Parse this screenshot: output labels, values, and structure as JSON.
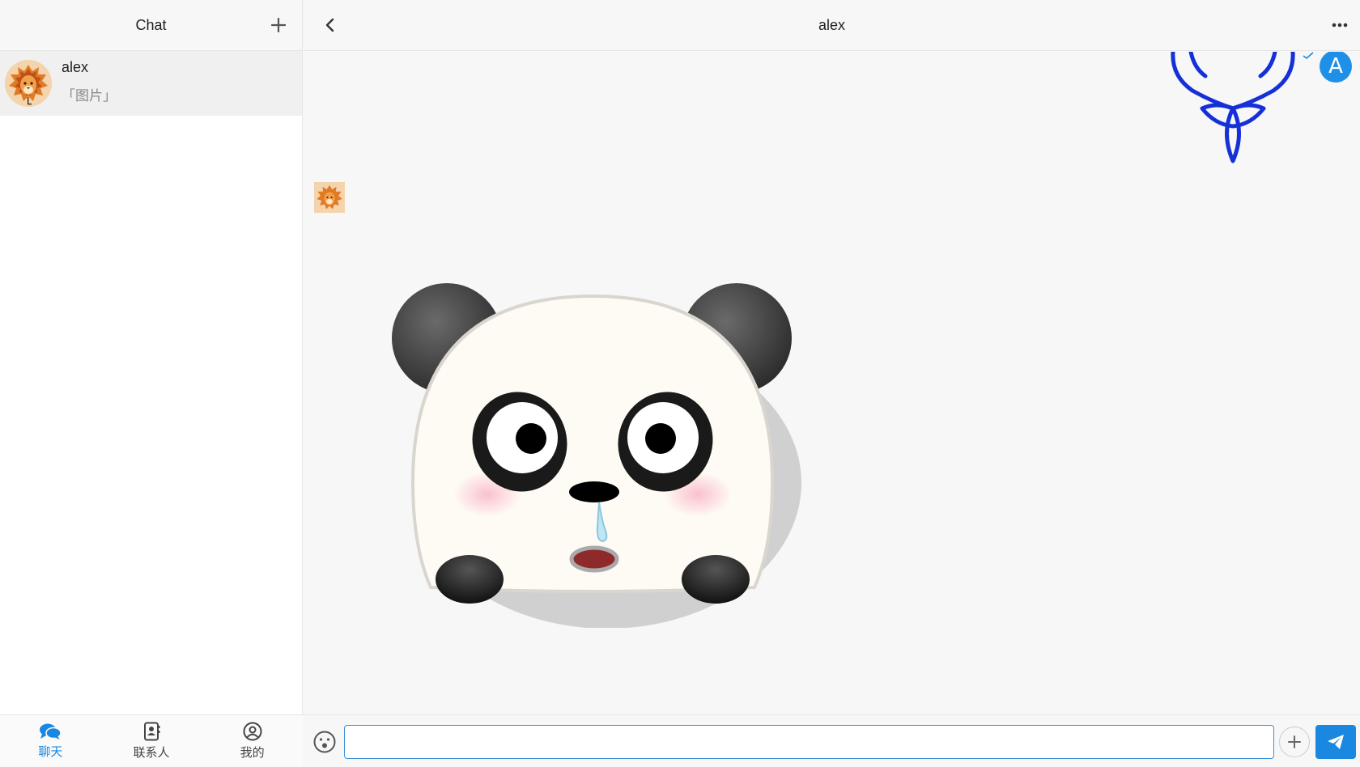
{
  "sidebar": {
    "title": "Chat",
    "add_icon": "plus-icon",
    "conversations": [
      {
        "name": "alex",
        "preview": "「图片」",
        "avatar_icon": "lion-avatar"
      }
    ]
  },
  "bottom_nav": {
    "items": [
      {
        "label": "聊天",
        "icon": "chat-bubbles-icon",
        "active": true
      },
      {
        "label": "联系人",
        "icon": "contacts-book-icon",
        "active": false
      },
      {
        "label": "我的",
        "icon": "user-circle-icon",
        "active": false
      }
    ]
  },
  "chat": {
    "title": "alex",
    "back_icon": "chevron-left-icon",
    "more_icon": "ellipsis-icon",
    "self_avatar_letter": "A",
    "messages": [
      {
        "from": "self",
        "type": "image",
        "image": "deer-antler-logo"
      },
      {
        "from": "alex",
        "type": "image",
        "image": "panda-sticker"
      }
    ]
  },
  "input": {
    "value": "",
    "placeholder": "",
    "emoji_icon": "emoji-face-icon",
    "plus_icon": "plus-icon",
    "send_icon": "paper-plane-icon"
  },
  "colors": {
    "accent": "#1a87e0",
    "avatar_blue": "#1f90e8",
    "deer_blue": "#1630d8"
  }
}
